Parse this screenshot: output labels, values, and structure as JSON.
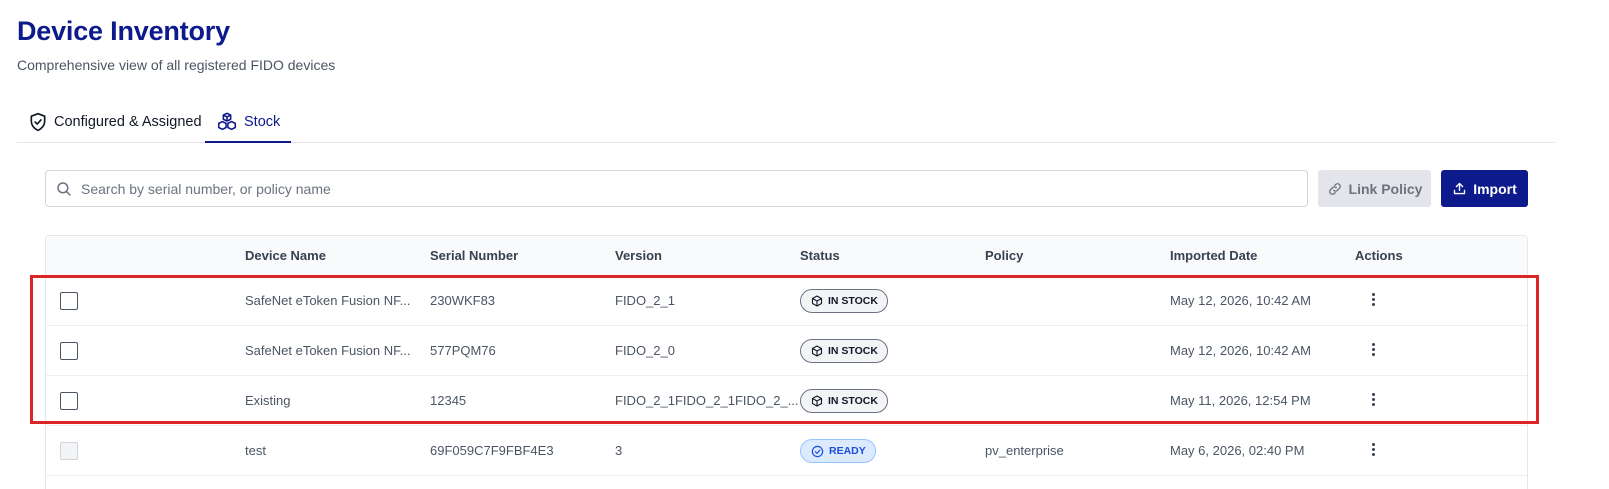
{
  "page": {
    "title": "Device Inventory",
    "subtitle": "Comprehensive view of all registered FIDO devices"
  },
  "tabs": [
    {
      "label": "Configured & Assigned",
      "icon": "shield-check-icon",
      "active": false
    },
    {
      "label": "Stock",
      "icon": "boxes-icon",
      "active": true
    }
  ],
  "search": {
    "placeholder": "Search by serial number, or policy name",
    "value": ""
  },
  "toolbar": {
    "link_policy_label": "Link Policy",
    "import_label": "Import"
  },
  "table": {
    "columns": [
      "Device Name",
      "Serial Number",
      "Version",
      "Status",
      "Policy",
      "Imported Date",
      "Actions"
    ],
    "rows": [
      {
        "name": "SafeNet eToken Fusion NF...",
        "serial": "230WKF83",
        "version": "FIDO_2_1",
        "status": "IN STOCK",
        "policy": "",
        "date": "May 12, 2026, 10:42 AM"
      },
      {
        "name": "SafeNet eToken Fusion NF...",
        "serial": "577PQM76",
        "version": "FIDO_2_0",
        "status": "IN STOCK",
        "policy": "",
        "date": "May 12, 2026, 10:42 AM"
      },
      {
        "name": "Existing",
        "serial": "12345",
        "version": "FIDO_2_1FIDO_2_1FIDO_2_...",
        "status": "IN STOCK",
        "policy": "",
        "date": "May 11, 2026, 12:54 PM"
      },
      {
        "name": "test",
        "serial": "69F059C7F9FBF4E3",
        "version": "3",
        "status": "READY",
        "policy": "pv_enterprise",
        "date": "May 6, 2026, 02:40 PM"
      }
    ]
  },
  "colors": {
    "brand": "#0d1a8c",
    "highlight": "#dc2626",
    "ready_bg": "#dbeafe",
    "ready_text": "#1d4ed8"
  }
}
